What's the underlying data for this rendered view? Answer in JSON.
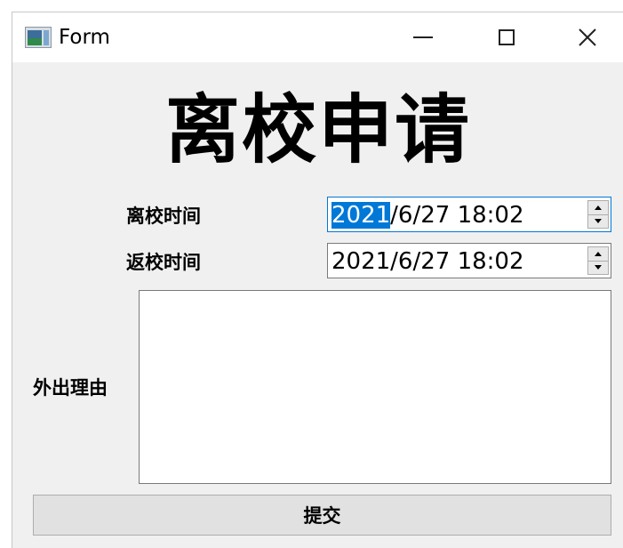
{
  "window": {
    "title": "Form",
    "icon": "form-app-icon",
    "controls": {
      "minimize": "minimize-icon",
      "maximize": "maximize-icon",
      "close": "×"
    }
  },
  "form": {
    "heading": "离校申请",
    "leave_time": {
      "label": "离校时间",
      "year": "2021",
      "rest": "/6/27 18:02"
    },
    "return_time": {
      "label": "返校时间",
      "value": "2021/6/27 18:02"
    },
    "reason": {
      "label": "外出理由",
      "value": ""
    },
    "submit_label": "提交"
  },
  "colors": {
    "selection": "#0078d7",
    "window_bg": "#f0f0f0",
    "button_bg": "#e1e1e1"
  }
}
